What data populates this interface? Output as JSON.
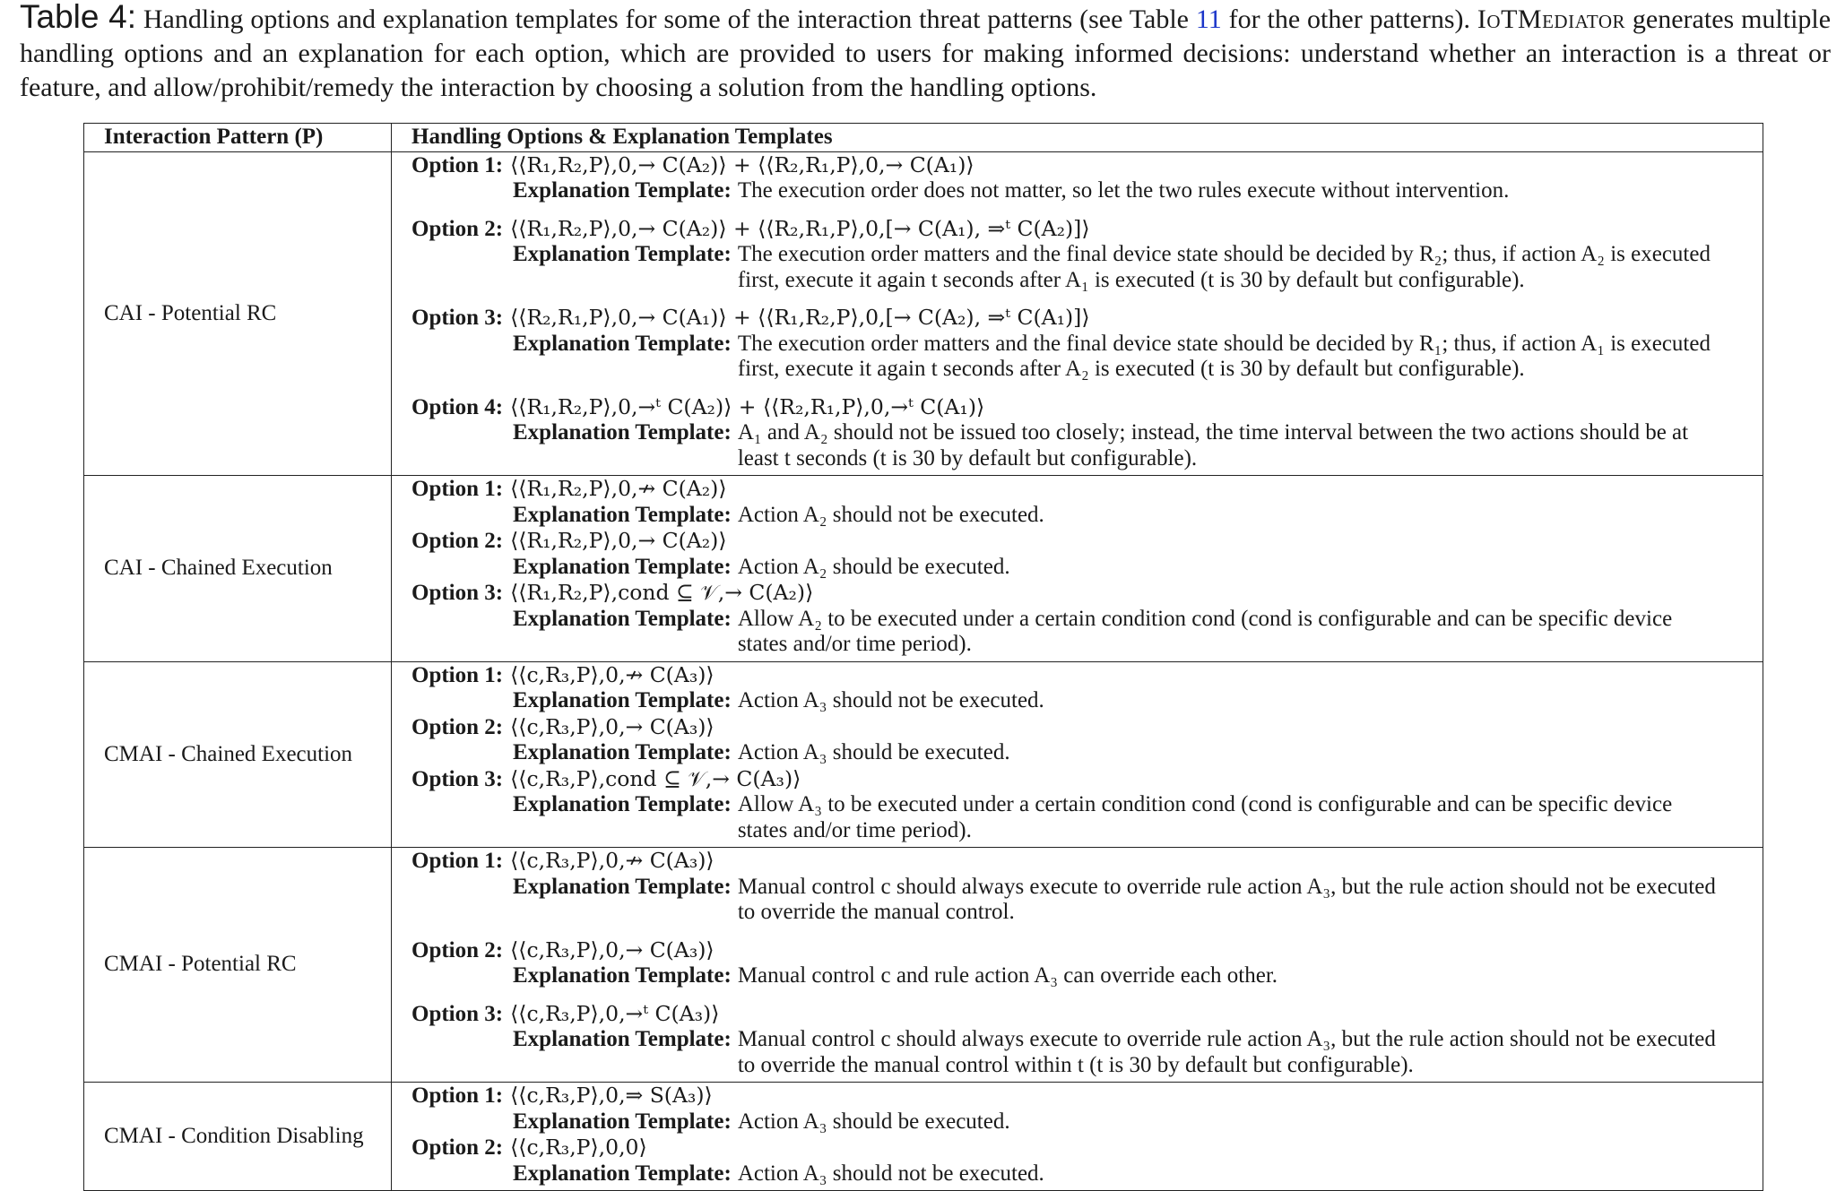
{
  "caption": {
    "label": "Table 4:",
    "text_before_ref": "Handling options and explanation templates for some of the interaction threat patterns (see Table",
    "ref": "11",
    "text_after_ref": "for the other patterns).",
    "system_name": "IoTMediator",
    "text_rest": "generates multiple handling options and an explanation for each option, which are provided to users for making informed decisions: understand whether an interaction is a threat or feature, and allow/prohibit/remedy the interaction by choosing a solution from the handling options."
  },
  "table": {
    "headers": [
      "Interaction Pattern (P)",
      "Handling Options & Explanation Templates"
    ],
    "explanation_label": "Explanation Template:",
    "rows": [
      {
        "pattern": "CAI - Potential RC",
        "options": [
          {
            "label": "Option 1:",
            "formula": "⟨⟨R₁,R₂,P⟩,0,→ C(A₂)⟩ + ⟨⟨R₂,R₁,P⟩,0,→ C(A₁)⟩",
            "explanation": "The execution order does not matter, so let the two rules execute without intervention."
          },
          {
            "label": "Option 2:",
            "formula": "⟨⟨R₁,R₂,P⟩,0,→ C(A₂)⟩ + ⟨⟨R₂,R₁,P⟩,0,[→ C(A₁), ⇒ᵗ C(A₂)]⟩",
            "explanation": "The execution order matters and the final device state should be decided by R₂; thus, if action A₂ is executed first, execute it again t seconds after A₁ is executed (t is 30 by default but configurable)."
          },
          {
            "label": "Option 3:",
            "formula": "⟨⟨R₂,R₁,P⟩,0,→ C(A₁)⟩ + ⟨⟨R₁,R₂,P⟩,0,[→ C(A₂), ⇒ᵗ C(A₁)]⟩",
            "explanation": "The execution order matters and the final device state should be decided by R₁; thus, if action A₁ is executed first, execute it again t seconds after A₂ is executed (t is 30 by default but configurable)."
          },
          {
            "label": "Option 4:",
            "formula": "⟨⟨R₁,R₂,P⟩,0,→ᵗ C(A₂)⟩ + ⟨⟨R₂,R₁,P⟩,0,→ᵗ C(A₁)⟩",
            "explanation": "A₁ and A₂ should not be issued too closely; instead, the time interval between the two actions should be at least t seconds (t is 30 by default but configurable)."
          }
        ]
      },
      {
        "pattern": "CAI - Chained Execution",
        "options": [
          {
            "label": "Option 1:",
            "formula": "⟨⟨R₁,R₂,P⟩,0,↛ C(A₂)⟩",
            "explanation": "Action A₂ should not be executed."
          },
          {
            "label": "Option 2:",
            "formula": "⟨⟨R₁,R₂,P⟩,0,→ C(A₂)⟩",
            "explanation": "Action A₂ should be executed."
          },
          {
            "label": "Option 3:",
            "formula": "⟨⟨R₁,R₂,P⟩,cond ⊆ 𝒱,→ C(A₂)⟩",
            "explanation": "Allow A₂ to be executed under a certain condition cond (cond is configurable and can be specific device states and/or time period)."
          }
        ]
      },
      {
        "pattern": "CMAI - Chained Execution",
        "options": [
          {
            "label": "Option 1:",
            "formula": "⟨⟨c,R₃,P⟩,0,↛ C(A₃)⟩",
            "explanation": "Action A₃ should not be executed."
          },
          {
            "label": "Option 2:",
            "formula": "⟨⟨c,R₃,P⟩,0,→ C(A₃)⟩",
            "explanation": "Action A₃ should be executed."
          },
          {
            "label": "Option 3:",
            "formula": "⟨⟨c,R₃,P⟩,cond ⊆ 𝒱,→ C(A₃)⟩",
            "explanation": "Allow A₃ to be executed under a certain condition cond (cond is configurable and can be specific device states and/or time period)."
          }
        ]
      },
      {
        "pattern": "CMAI - Potential RC",
        "options": [
          {
            "label": "Option 1:",
            "formula": "⟨⟨c,R₃,P⟩,0,↛ C(A₃)⟩",
            "explanation": "Manual control c should always execute to override rule action A₃, but the rule action should not be executed to override the manual control."
          },
          {
            "label": "Option 2:",
            "formula": "⟨⟨c,R₃,P⟩,0,→ C(A₃)⟩",
            "explanation": "Manual control c and rule action A₃ can override each other."
          },
          {
            "label": "Option 3:",
            "formula": "⟨⟨c,R₃,P⟩,0,→ᵗ C(A₃)⟩",
            "explanation": "Manual control c should always execute to override rule action A₃, but the rule action should not be executed to override the manual control within t (t is 30 by default but configurable)."
          }
        ]
      },
      {
        "pattern": "CMAI - Condition Disabling",
        "options": [
          {
            "label": "Option 1:",
            "formula": "⟨⟨c,R₃,P⟩,0,⇒ S(A₃)⟩",
            "explanation": "Action A₃ should be executed."
          },
          {
            "label": "Option 2:",
            "formula": "⟨⟨c,R₃,P⟩,0,0⟩",
            "explanation": "Action A₃ should not be executed."
          }
        ]
      }
    ]
  }
}
